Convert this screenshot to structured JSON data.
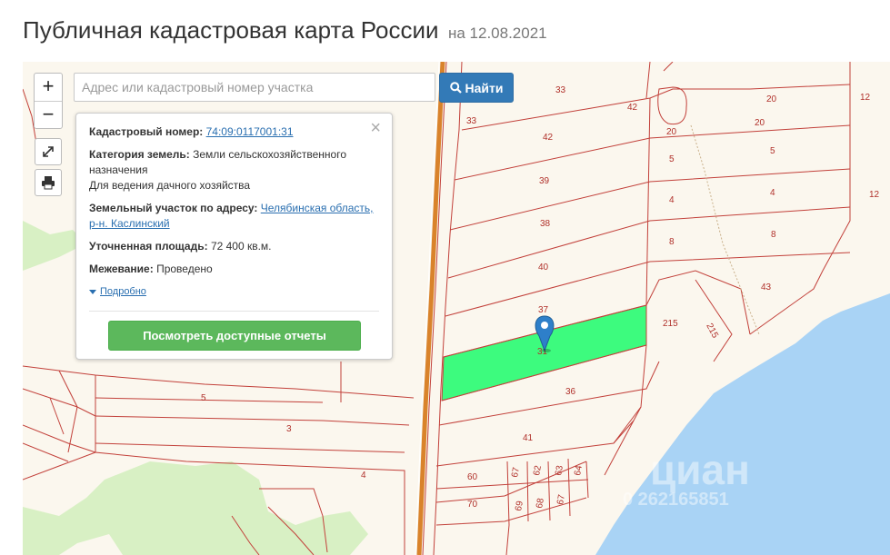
{
  "header": {
    "title": "Публичная кадастровая карта России",
    "date": "на 12.08.2021"
  },
  "toolbar": {
    "zoom_in": "+",
    "zoom_out": "−",
    "fullscreen_icon": "expand-icon",
    "print_icon": "printer-icon"
  },
  "search": {
    "placeholder": "Адрес или кадастровый номер участка",
    "value": "",
    "button_label": "Найти",
    "button_icon": "search-icon"
  },
  "info_panel": {
    "cadastral_label": "Кадастровый номер:",
    "cadastral_value": "74:09:0117001:31",
    "category_label": "Категория земель:",
    "category_value": "Земли сельскохозяйственного назначения",
    "use_value": "Для ведения дачного хозяйства",
    "address_label": "Земельный участок по адресу:",
    "address_value": "Челябинская область, р-н. Каслинский",
    "area_label": "Уточненная площадь:",
    "area_value": "72 400 кв.м.",
    "survey_label": "Межевание:",
    "survey_value": "Проведено",
    "more_link": "Подробно",
    "report_button": "Посмотреть доступные отчеты",
    "close": "×"
  },
  "map": {
    "colors": {
      "background": "#fbf7ee",
      "parcel_line": "#c2403a",
      "selected_parcel": "#3dfb7e",
      "water": "#a9d3f5",
      "forest": "#d8f0c4",
      "road": "#d9832b",
      "marker": "#2e7fc9"
    },
    "plot_labels": [
      "33",
      "42",
      "20",
      "12",
      "33",
      "42",
      "20",
      "20",
      "5",
      "5",
      "39",
      "4",
      "4",
      "12",
      "38",
      "8",
      "8",
      "40",
      "43",
      "37",
      "215",
      "215",
      "31",
      "36",
      "5",
      "3",
      "41",
      "4",
      "60",
      "67",
      "62",
      "63",
      "64",
      "70",
      "69",
      "68",
      "67"
    ],
    "watermark": "циан",
    "watermark_phone": "0 262165851"
  }
}
